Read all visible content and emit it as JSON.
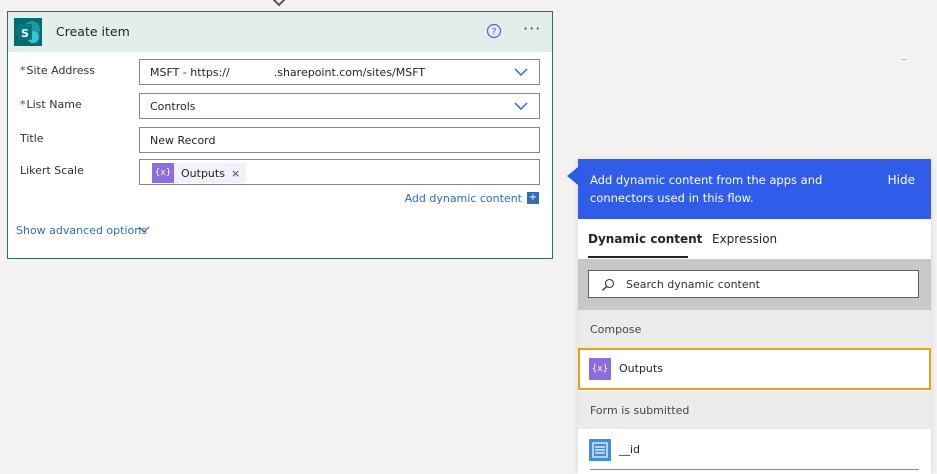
{
  "card": {
    "title": "Create item",
    "fields": [
      {
        "label": "Site Address",
        "required": true,
        "value": "MSFT - https://    .sharepoint.com/sites/MSFT"
      },
      {
        "label": "List Name",
        "required": true,
        "value": "Controls"
      },
      {
        "label": "Title",
        "required": false,
        "value": "New Record"
      },
      {
        "label": "Likert Scale",
        "required": false,
        "token": "Outputs"
      }
    ],
    "required_marker": "*",
    "add_dynamic_label": "Add dynamic content",
    "add_dynamic_icon": "+",
    "show_advanced_label": "Show advanced options",
    "more_label": "···",
    "token_glyph": "{x}",
    "token_remove": "×"
  },
  "panel": {
    "header_text": "Add dynamic content from the apps and connectors used in this flow.",
    "hide_label": "Hide",
    "tabs": [
      {
        "label": "Dynamic content",
        "active": true
      },
      {
        "label": "Expression",
        "active": false
      }
    ],
    "search_placeholder": "Search dynamic content",
    "sections": [
      {
        "title": "Compose",
        "items": [
          {
            "label": "Outputs",
            "icon": "compose-icon",
            "glyph": "{x}"
          }
        ]
      },
      {
        "title": "Form is submitted",
        "items": [
          {
            "label": "__id",
            "icon": "forms-icon"
          }
        ]
      }
    ]
  },
  "colors": {
    "card_border": "#2e6d67",
    "card_header": "#e1eeec",
    "panel_header": "#2f5ce9",
    "link": "#2f6fb5",
    "token": "#8c6cdf",
    "highlight": "#e3a21a",
    "forms": "#3f8fd4"
  }
}
